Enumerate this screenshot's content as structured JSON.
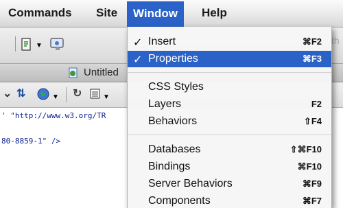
{
  "menubar": {
    "items": [
      "Commands",
      "Site",
      "Window",
      "Help"
    ],
    "active": "Window"
  },
  "toolbar": {
    "partial_text": "th"
  },
  "doc_tab": {
    "title": "Untitled"
  },
  "code": {
    "line1": "' \"http://www.w3.org/TR",
    "line2": "80-8859-1\" />"
  },
  "window_menu": {
    "groups": [
      [
        {
          "label": "Insert",
          "checked": true,
          "shortcut": "⌘F2",
          "selected": false
        },
        {
          "label": "Properties",
          "checked": true,
          "shortcut": "⌘F3",
          "selected": true
        }
      ],
      [
        {
          "label": "CSS Styles",
          "checked": false,
          "shortcut": "",
          "selected": false
        },
        {
          "label": "Layers",
          "checked": false,
          "shortcut": "F2",
          "selected": false
        },
        {
          "label": "Behaviors",
          "checked": false,
          "shortcut": "⇧F4",
          "selected": false
        }
      ],
      [
        {
          "label": "Databases",
          "checked": false,
          "shortcut": "⇧⌘F10",
          "selected": false
        },
        {
          "label": "Bindings",
          "checked": false,
          "shortcut": "⌘F10",
          "selected": false
        },
        {
          "label": "Server Behaviors",
          "checked": false,
          "shortcut": "⌘F9",
          "selected": false
        },
        {
          "label": "Components",
          "checked": false,
          "shortcut": "⌘F7",
          "selected": false
        }
      ]
    ]
  },
  "colors": {
    "selection": "#2b62c7"
  }
}
